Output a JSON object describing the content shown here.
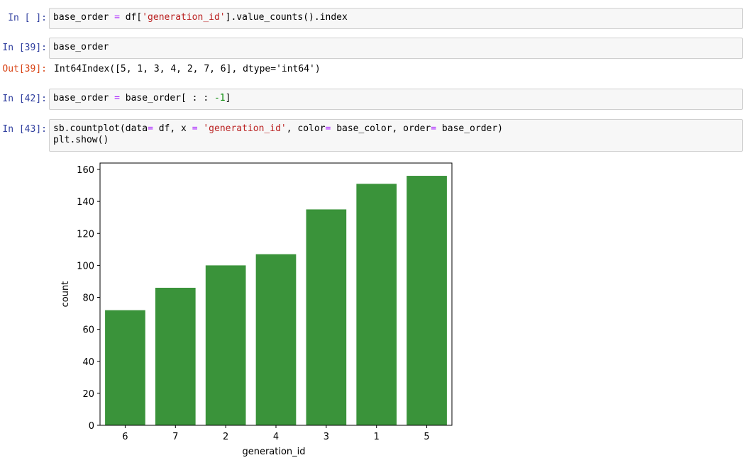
{
  "cells": [
    {
      "prompt": "In [ ]:",
      "code": [
        [
          [
            "base_order ",
            "plain"
          ],
          [
            "=",
            "op"
          ],
          [
            " df[",
            "plain"
          ],
          [
            "'generation_id'",
            "str"
          ],
          [
            "].value_counts().index",
            "plain"
          ]
        ]
      ]
    },
    {
      "prompt": "In [39]:",
      "code": [
        [
          [
            "base_order",
            "plain"
          ]
        ]
      ],
      "out_prompt": "Out[39]:",
      "output": "Int64Index([5, 1, 3, 4, 2, 7, 6], dtype='int64')"
    },
    {
      "prompt": "In [42]:",
      "code": [
        [
          [
            "base_order ",
            "plain"
          ],
          [
            "=",
            "op"
          ],
          [
            " base_order[ : : ",
            "plain"
          ],
          [
            "-1",
            "num"
          ],
          [
            "]",
            "plain"
          ]
        ]
      ]
    },
    {
      "prompt": "In [43]:",
      "code": [
        [
          [
            "sb.countplot(data",
            "plain"
          ],
          [
            "=",
            "op"
          ],
          [
            " df, x ",
            "plain"
          ],
          [
            "=",
            "op"
          ],
          [
            " ",
            "plain"
          ],
          [
            "'generation_id'",
            "str"
          ],
          [
            ", color",
            "plain"
          ],
          [
            "=",
            "op"
          ],
          [
            " base_color, order",
            "plain"
          ],
          [
            "=",
            "op"
          ],
          [
            " base_order)",
            "plain"
          ]
        ],
        [
          [
            "plt.show()",
            "plain"
          ]
        ]
      ]
    }
  ],
  "chart_data": {
    "type": "bar",
    "categories": [
      "6",
      "7",
      "2",
      "4",
      "3",
      "1",
      "5"
    ],
    "values": [
      72,
      86,
      100,
      107,
      135,
      151,
      156
    ],
    "xlabel": "generation_id",
    "ylabel": "count",
    "ylim": [
      0,
      164
    ],
    "yticks": [
      0,
      20,
      40,
      60,
      80,
      100,
      120,
      140,
      160
    ],
    "grid": false,
    "color": "#3a933a"
  }
}
